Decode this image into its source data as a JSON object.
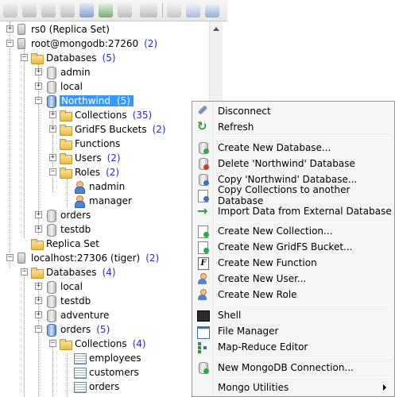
{
  "toolbar": {
    "buttons": [
      "new-connection-icon",
      "disconnect-icon",
      "copy-icon",
      "export-icon",
      "connect-icon",
      "refresh-icon",
      "shell-icon",
      "new-database-icon",
      "new-collection-icon",
      "import-icon"
    ]
  },
  "tree": {
    "replica_set": {
      "label": "rs0 (Replica Set)"
    },
    "conn1": {
      "label": "root@mongodb:27260",
      "count": "(2)"
    },
    "databases1": {
      "label": "Databases",
      "count": "(5)"
    },
    "admin": {
      "label": "admin"
    },
    "local1": {
      "label": "local"
    },
    "northwind": {
      "label": "Northwind",
      "count": "(5)"
    },
    "collections1": {
      "label": "Collections",
      "count": "(35)"
    },
    "gridfs": {
      "label": "GridFS Buckets",
      "count": "(2)"
    },
    "functions": {
      "label": "Functions"
    },
    "users": {
      "label": "Users",
      "count": "(2)"
    },
    "roles": {
      "label": "Roles",
      "count": "(2)"
    },
    "nadmin": {
      "label": "nadmin"
    },
    "manager": {
      "label": "manager"
    },
    "orders1": {
      "label": "orders"
    },
    "testdb1": {
      "label": "testdb"
    },
    "replica_folder": {
      "label": "Replica Set"
    },
    "conn2": {
      "label": "localhost:27306 (tiger)",
      "count": "(2)"
    },
    "databases2": {
      "label": "Databases",
      "count": "(4)"
    },
    "local2": {
      "label": "local"
    },
    "testdb2": {
      "label": "testdb"
    },
    "adventure": {
      "label": "adventure"
    },
    "orders2": {
      "label": "orders",
      "count": "(5)"
    },
    "collections2": {
      "label": "Collections",
      "count": "(4)"
    },
    "employees": {
      "label": "employees"
    },
    "customers": {
      "label": "customers"
    },
    "orders3": {
      "label": "orders"
    }
  },
  "menu": {
    "disconnect": "Disconnect",
    "refresh": "Refresh",
    "create_db": "Create New Database...",
    "delete_db": "Delete 'Northwind' Database",
    "copy_db": "Copy 'Northwind' Database...",
    "copy_collections": "Copy Collections to another Database",
    "import_data": "Import Data from External Database",
    "create_collection": "Create New Collection...",
    "create_gridfs": "Create New GridFS Bucket...",
    "create_function": "Create New Function",
    "create_user": "Create New User...",
    "create_role": "Create New Role",
    "shell": "Shell",
    "file_manager": "File Manager",
    "map_reduce": "Map-Reduce Editor",
    "new_connection": "New MongoDB Connection...",
    "utilities": "Mongo Utilities"
  }
}
